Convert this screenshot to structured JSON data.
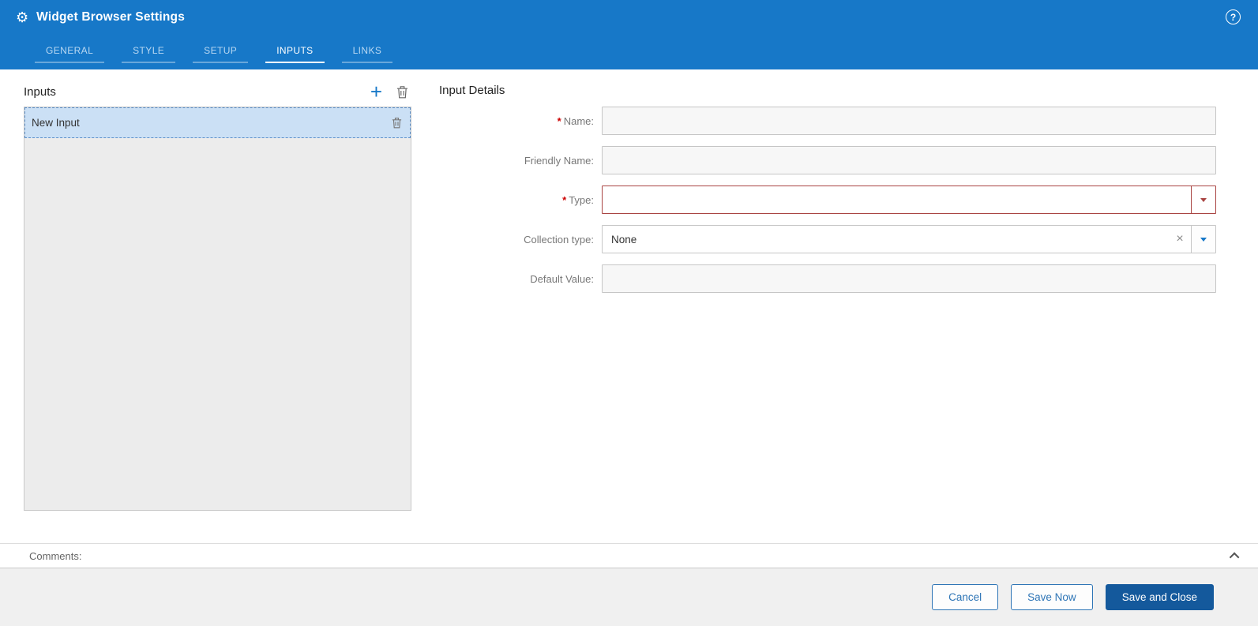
{
  "colors": {
    "header_bg": "#1778c8",
    "accent_blue": "#1778c8",
    "error_red": "#a94442",
    "required_red": "#cc0000",
    "selected_item_bg": "#cbe0f5",
    "primary_button_bg": "#14599c",
    "footer_bg": "#f0f0f0"
  },
  "header": {
    "title": "Widget Browser Settings",
    "gear_icon": "⚙",
    "help_icon": "?"
  },
  "tabs": [
    {
      "label": "GENERAL",
      "active": false
    },
    {
      "label": "STYLE",
      "active": false
    },
    {
      "label": "SETUP",
      "active": false
    },
    {
      "label": "INPUTS",
      "active": true
    },
    {
      "label": "LINKS",
      "active": false
    }
  ],
  "inputs_panel": {
    "title": "Inputs",
    "add_icon": "+",
    "items": [
      {
        "label": "New Input",
        "selected": true
      }
    ]
  },
  "details_panel": {
    "title": "Input Details",
    "required_marker": "*",
    "fields": {
      "name": {
        "label": "Name:",
        "required": true,
        "value": ""
      },
      "friendly_name": {
        "label": "Friendly Name:",
        "required": false,
        "value": ""
      },
      "type": {
        "label": "Type:",
        "required": true,
        "value": "",
        "error": true
      },
      "collection_type": {
        "label": "Collection type:",
        "required": false,
        "value": "None",
        "clear_icon": "×"
      },
      "default_value": {
        "label": "Default Value:",
        "required": false,
        "value": ""
      }
    }
  },
  "comments": {
    "label": "Comments:"
  },
  "footer": {
    "cancel_label": "Cancel",
    "save_now_label": "Save Now",
    "save_close_label": "Save and Close"
  }
}
